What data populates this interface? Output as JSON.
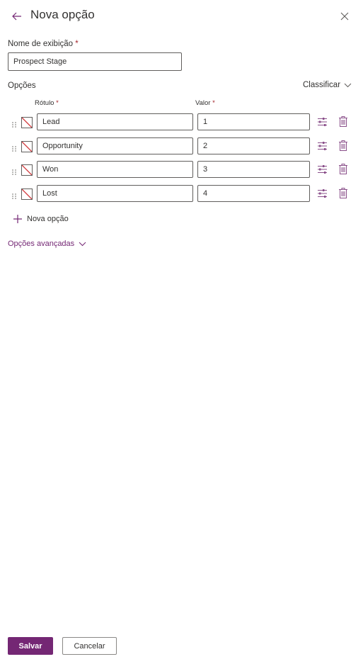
{
  "header": {
    "title": "Nova opção",
    "back_icon": "arrow-left-icon",
    "close_icon": "close-icon"
  },
  "display_name": {
    "label": "Nome de exibição",
    "required_mark": "*",
    "value": "Prospect Stage"
  },
  "options_section": {
    "label": "Opções",
    "sort_label": "Classificar",
    "columns": {
      "label": "Rótulo",
      "value": "Valor",
      "required_mark": "*"
    },
    "items": [
      {
        "label": "Lead",
        "value": "1"
      },
      {
        "label": "Opportunity",
        "value": "2"
      },
      {
        "label": "Won",
        "value": "3"
      },
      {
        "label": "Lost",
        "value": "4"
      }
    ],
    "add_option_label": "Nova opção",
    "advanced_label": "Opções avançadas"
  },
  "footer": {
    "save_label": "Salvar",
    "cancel_label": "Cancelar"
  },
  "colors": {
    "accent": "#742774",
    "required": "#a4262c",
    "border": "#605e5c",
    "text": "#323130"
  }
}
